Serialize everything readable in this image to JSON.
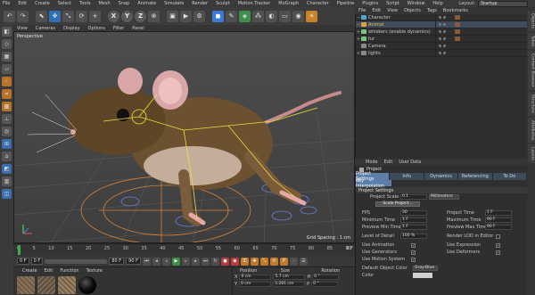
{
  "menubar": {
    "items": [
      "File",
      "Edit",
      "Create",
      "Select",
      "Tools",
      "Mesh",
      "Snap",
      "Animate",
      "Simulate",
      "Render",
      "Sculpt",
      "Motion Tracker",
      "MoGraph",
      "Character",
      "Pipeline",
      "Plugins",
      "Script",
      "Window",
      "Help"
    ],
    "layout_label": "Layout:",
    "layout_value": "Startup"
  },
  "toolbar": {
    "icons": [
      "undo-icon",
      "redo-icon",
      "live-select-icon",
      "move-icon",
      "scale-icon",
      "rotate-icon",
      "add-icon",
      "x-axis-icon",
      "y-axis-icon",
      "z-axis-icon",
      "coordinate-system-icon",
      "render-region-icon",
      "render-view-icon",
      "render-settings-icon",
      "cube-icon",
      "pen-icon",
      "subdivision-icon",
      "array-icon",
      "deformer-icon",
      "floor-icon",
      "camera-icon",
      "light-icon"
    ],
    "x": "X",
    "y": "Y",
    "z": "Z"
  },
  "viewport": {
    "menu": [
      "View",
      "Cameras",
      "Display",
      "Options",
      "Filter",
      "Panel"
    ],
    "label": "Perspective",
    "status": "Grid Spacing : 1 cm"
  },
  "timeline": {
    "ticks": [
      "0",
      "5",
      "10",
      "15",
      "20",
      "25",
      "30",
      "35",
      "40",
      "45",
      "50",
      "55",
      "60",
      "65",
      "70",
      "75",
      "80",
      "85",
      "90"
    ],
    "end": "0 F"
  },
  "transport": {
    "start": "0 F",
    "min": "0 F",
    "max": "80 F",
    "end": "90 F"
  },
  "material_manager": {
    "menu": [
      "Create",
      "Edit",
      "Function",
      "Texture"
    ]
  },
  "coord_manager": {
    "headers": [
      "Position",
      "Size",
      "Rotation"
    ],
    "rows": [
      {
        "axis": "X",
        "pos": "0 cm",
        "size": "5.7 cm",
        "rot_axis": "H",
        "rot": "0 °"
      },
      {
        "axis": "Y",
        "pos": "0 cm",
        "size": "3.281 cm",
        "rot_axis": "P",
        "rot": "0 °"
      }
    ]
  },
  "object_manager": {
    "menu": [
      "File",
      "Edit",
      "View",
      "Objects",
      "Tags",
      "Bookmarks"
    ],
    "objects": [
      {
        "name": "Character",
        "color": "#4aa8d8",
        "selected": false
      },
      {
        "name": "Animal",
        "color": "#e0a23a",
        "selected": true
      },
      {
        "name": "whiskers (enable dynamics)",
        "color": "#7bc47f",
        "selected": false
      },
      {
        "name": "fur",
        "color": "#7bc47f",
        "selected": false
      },
      {
        "name": "Camera",
        "color": "#8a8a8a",
        "selected": false
      },
      {
        "name": "lights",
        "color": "#8a8a8a",
        "selected": false
      }
    ]
  },
  "attribute_manager": {
    "menu": [
      "Mode",
      "Edit",
      "User Data"
    ],
    "title": "Project",
    "tabs": [
      "Project Settings",
      "Info",
      "Dynamics",
      "Referencing",
      "To Do"
    ],
    "subtab": "Key Interpolation",
    "section": "Project Settings",
    "project_scale_label": "Project Scale",
    "project_scale": "0.1",
    "project_scale_unit": "Millimeters",
    "scale_button": "Scale Project...",
    "fps_label": "FPS",
    "fps": "30",
    "project_time_label": "Project Time",
    "project_time": "1 F",
    "min_time_label": "Minimum Time",
    "min_time": "1 F",
    "max_time_label": "Maximum Time",
    "max_time": "90 F",
    "prev_min_label": "Preview Min Time",
    "prev_min": "1 F",
    "prev_max_label": "Preview Max Time",
    "prev_max": "90 F",
    "lod_label": "Level of Detail",
    "lod": "100 %",
    "render_lod_label": "Render LOD in Editor",
    "use_animation_label": "Use Animation",
    "use_expression_label": "Use Expression",
    "use_generators_label": "Use Generators",
    "use_deformers_label": "Use Deformers",
    "use_motion_label": "Use Motion System",
    "default_color_label": "Default Object Color",
    "default_color": "Gray-Blue",
    "color_label": "Color"
  },
  "side_tabs": [
    "Objects",
    "Takes",
    "Content Browser",
    "Structure",
    "Attributes",
    "Layers"
  ]
}
